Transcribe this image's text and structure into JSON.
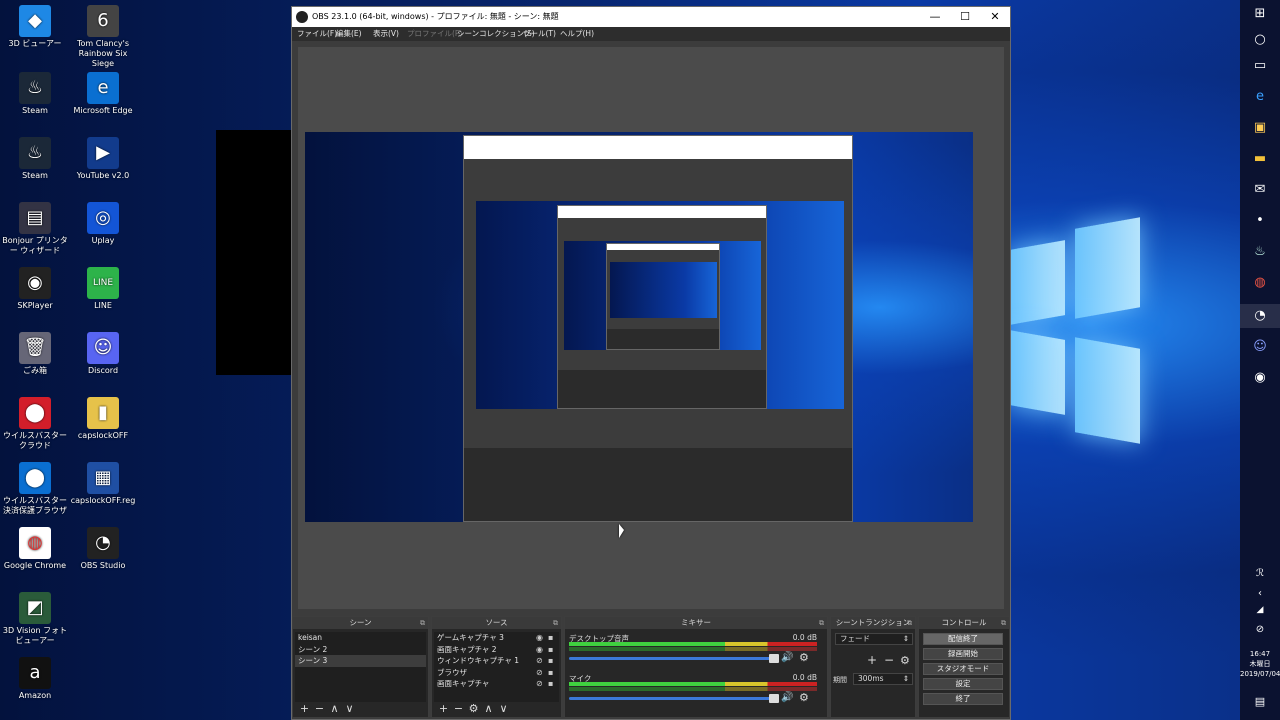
{
  "desktop": {
    "icons": [
      {
        "label": "3D ビューアー",
        "glyph": "◆"
      },
      {
        "label": "Tom Clancy's Rainbow Six Siege",
        "glyph": "6"
      },
      {
        "label": "Steam",
        "glyph": "♨"
      },
      {
        "label": "Microsoft Edge",
        "glyph": "e"
      },
      {
        "label": "Steam",
        "glyph": "♨"
      },
      {
        "label": "YouTube v2.0",
        "glyph": "▶"
      },
      {
        "label": "Bonjour プリンター ウィザード",
        "glyph": "▤"
      },
      {
        "label": "Uplay",
        "glyph": "◎"
      },
      {
        "label": "SKPlayer",
        "glyph": "◉"
      },
      {
        "label": "LINE",
        "glyph": "LINE"
      },
      {
        "label": "ごみ箱",
        "glyph": "🗑"
      },
      {
        "label": "Discord",
        "glyph": "☺"
      },
      {
        "label": "ウイルスバスター クラウド",
        "glyph": "⬤"
      },
      {
        "label": "capslockOFF",
        "glyph": "▮"
      },
      {
        "label": "ウイルスバスター 決済保護ブラウザ",
        "glyph": "⬤"
      },
      {
        "label": "capslockOFF.reg",
        "glyph": "▦"
      },
      {
        "label": "Google Chrome",
        "glyph": "◍"
      },
      {
        "label": "OBS Studio",
        "glyph": "◔"
      },
      {
        "label": "3D Vision フォトビューアー",
        "glyph": "◩"
      },
      {
        "label": "Amazon",
        "glyph": "a"
      }
    ]
  },
  "taskbar": {
    "icons": [
      "windows-icon",
      "cortana-icon",
      "task-view-icon",
      "edge-icon",
      "store-icon",
      "explorer-icon",
      "mail-icon",
      "more-icon",
      "steam-icon",
      "chrome-icon",
      "obs-icon",
      "discord-icon",
      "skplayer-icon"
    ],
    "clock_time": "16:47",
    "clock_day": "木曜日",
    "clock_date": "2019/07/04"
  },
  "obs": {
    "title": "OBS 23.1.0 (64-bit, windows) - プロファイル: 無題 - シーン: 無題",
    "menu": [
      {
        "label": "ファイル(F)",
        "enabled": true
      },
      {
        "label": "編集(E)",
        "enabled": true
      },
      {
        "label": "表示(V)",
        "enabled": true
      },
      {
        "label": "プロファイル(P)",
        "enabled": false
      },
      {
        "label": "シーンコレクション(S)",
        "enabled": true
      },
      {
        "label": "ツール(T)",
        "enabled": true
      },
      {
        "label": "ヘルプ(H)",
        "enabled": true
      }
    ],
    "scenes": {
      "title": "シーン",
      "items": [
        "keisan",
        "シーン 2",
        "シーン 3"
      ],
      "selected": 2
    },
    "sources": {
      "title": "ソース",
      "items": [
        "ゲームキャプチャ 3",
        "画面キャプチャ 2",
        "ウィンドウキャプチャ 1",
        "ブラウザ",
        "画面キャプチャ"
      ]
    },
    "mixer": {
      "title": "ミキサー",
      "channels": [
        {
          "name": "デスクトップ音声",
          "db": "0.0 dB"
        },
        {
          "name": "マイク",
          "db": "0.0 dB"
        }
      ]
    },
    "transitions": {
      "title": "シーントランジション",
      "type": "フェード",
      "duration_label": "期間",
      "duration_value": "300ms"
    },
    "controls": {
      "title": "コントロール",
      "buttons": [
        "配信終了",
        "録画開始",
        "スタジオモード",
        "設定",
        "終了"
      ]
    },
    "tools": {
      "add": "+",
      "remove": "−",
      "up": "∧",
      "down": "∨",
      "gear": "⚙"
    }
  }
}
